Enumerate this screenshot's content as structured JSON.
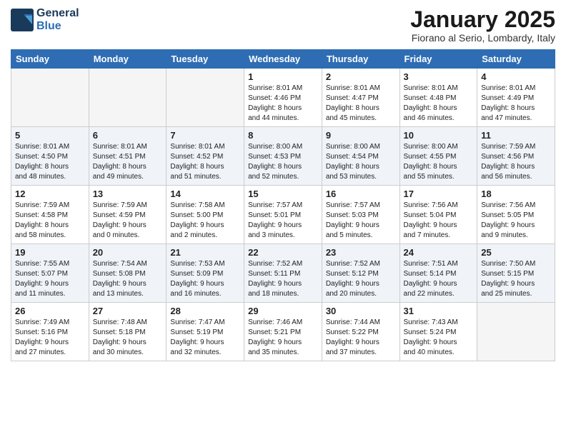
{
  "logo": {
    "line1": "General",
    "line2": "Blue"
  },
  "title": "January 2025",
  "location": "Fiorano al Serio, Lombardy, Italy",
  "headers": [
    "Sunday",
    "Monday",
    "Tuesday",
    "Wednesday",
    "Thursday",
    "Friday",
    "Saturday"
  ],
  "weeks": [
    [
      {
        "day": "",
        "info": ""
      },
      {
        "day": "",
        "info": ""
      },
      {
        "day": "",
        "info": ""
      },
      {
        "day": "1",
        "info": "Sunrise: 8:01 AM\nSunset: 4:46 PM\nDaylight: 8 hours\nand 44 minutes."
      },
      {
        "day": "2",
        "info": "Sunrise: 8:01 AM\nSunset: 4:47 PM\nDaylight: 8 hours\nand 45 minutes."
      },
      {
        "day": "3",
        "info": "Sunrise: 8:01 AM\nSunset: 4:48 PM\nDaylight: 8 hours\nand 46 minutes."
      },
      {
        "day": "4",
        "info": "Sunrise: 8:01 AM\nSunset: 4:49 PM\nDaylight: 8 hours\nand 47 minutes."
      }
    ],
    [
      {
        "day": "5",
        "info": "Sunrise: 8:01 AM\nSunset: 4:50 PM\nDaylight: 8 hours\nand 48 minutes."
      },
      {
        "day": "6",
        "info": "Sunrise: 8:01 AM\nSunset: 4:51 PM\nDaylight: 8 hours\nand 49 minutes."
      },
      {
        "day": "7",
        "info": "Sunrise: 8:01 AM\nSunset: 4:52 PM\nDaylight: 8 hours\nand 51 minutes."
      },
      {
        "day": "8",
        "info": "Sunrise: 8:00 AM\nSunset: 4:53 PM\nDaylight: 8 hours\nand 52 minutes."
      },
      {
        "day": "9",
        "info": "Sunrise: 8:00 AM\nSunset: 4:54 PM\nDaylight: 8 hours\nand 53 minutes."
      },
      {
        "day": "10",
        "info": "Sunrise: 8:00 AM\nSunset: 4:55 PM\nDaylight: 8 hours\nand 55 minutes."
      },
      {
        "day": "11",
        "info": "Sunrise: 7:59 AM\nSunset: 4:56 PM\nDaylight: 8 hours\nand 56 minutes."
      }
    ],
    [
      {
        "day": "12",
        "info": "Sunrise: 7:59 AM\nSunset: 4:58 PM\nDaylight: 8 hours\nand 58 minutes."
      },
      {
        "day": "13",
        "info": "Sunrise: 7:59 AM\nSunset: 4:59 PM\nDaylight: 9 hours\nand 0 minutes."
      },
      {
        "day": "14",
        "info": "Sunrise: 7:58 AM\nSunset: 5:00 PM\nDaylight: 9 hours\nand 2 minutes."
      },
      {
        "day": "15",
        "info": "Sunrise: 7:57 AM\nSunset: 5:01 PM\nDaylight: 9 hours\nand 3 minutes."
      },
      {
        "day": "16",
        "info": "Sunrise: 7:57 AM\nSunset: 5:03 PM\nDaylight: 9 hours\nand 5 minutes."
      },
      {
        "day": "17",
        "info": "Sunrise: 7:56 AM\nSunset: 5:04 PM\nDaylight: 9 hours\nand 7 minutes."
      },
      {
        "day": "18",
        "info": "Sunrise: 7:56 AM\nSunset: 5:05 PM\nDaylight: 9 hours\nand 9 minutes."
      }
    ],
    [
      {
        "day": "19",
        "info": "Sunrise: 7:55 AM\nSunset: 5:07 PM\nDaylight: 9 hours\nand 11 minutes."
      },
      {
        "day": "20",
        "info": "Sunrise: 7:54 AM\nSunset: 5:08 PM\nDaylight: 9 hours\nand 13 minutes."
      },
      {
        "day": "21",
        "info": "Sunrise: 7:53 AM\nSunset: 5:09 PM\nDaylight: 9 hours\nand 16 minutes."
      },
      {
        "day": "22",
        "info": "Sunrise: 7:52 AM\nSunset: 5:11 PM\nDaylight: 9 hours\nand 18 minutes."
      },
      {
        "day": "23",
        "info": "Sunrise: 7:52 AM\nSunset: 5:12 PM\nDaylight: 9 hours\nand 20 minutes."
      },
      {
        "day": "24",
        "info": "Sunrise: 7:51 AM\nSunset: 5:14 PM\nDaylight: 9 hours\nand 22 minutes."
      },
      {
        "day": "25",
        "info": "Sunrise: 7:50 AM\nSunset: 5:15 PM\nDaylight: 9 hours\nand 25 minutes."
      }
    ],
    [
      {
        "day": "26",
        "info": "Sunrise: 7:49 AM\nSunset: 5:16 PM\nDaylight: 9 hours\nand 27 minutes."
      },
      {
        "day": "27",
        "info": "Sunrise: 7:48 AM\nSunset: 5:18 PM\nDaylight: 9 hours\nand 30 minutes."
      },
      {
        "day": "28",
        "info": "Sunrise: 7:47 AM\nSunset: 5:19 PM\nDaylight: 9 hours\nand 32 minutes."
      },
      {
        "day": "29",
        "info": "Sunrise: 7:46 AM\nSunset: 5:21 PM\nDaylight: 9 hours\nand 35 minutes."
      },
      {
        "day": "30",
        "info": "Sunrise: 7:44 AM\nSunset: 5:22 PM\nDaylight: 9 hours\nand 37 minutes."
      },
      {
        "day": "31",
        "info": "Sunrise: 7:43 AM\nSunset: 5:24 PM\nDaylight: 9 hours\nand 40 minutes."
      },
      {
        "day": "",
        "info": ""
      }
    ]
  ]
}
